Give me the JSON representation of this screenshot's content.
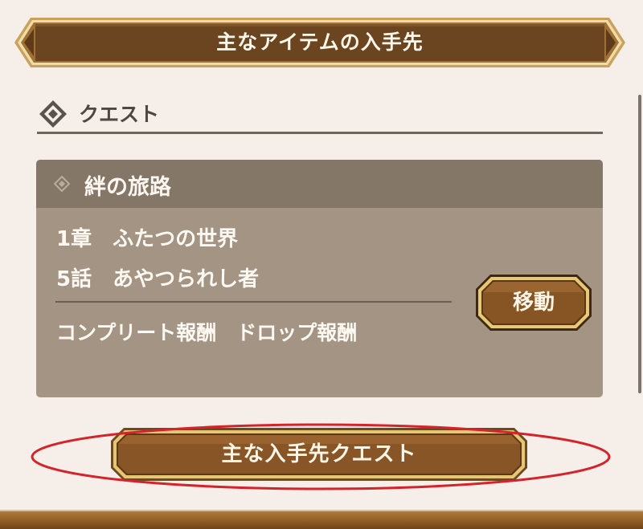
{
  "header": {
    "title": "主なアイテムの入手先"
  },
  "section": {
    "title": "クエスト",
    "icon": "diamond-icon"
  },
  "quest_card": {
    "name": "絆の旅路",
    "chapter": "1章　ふたつの世界",
    "episode": "5話　あやつられし者",
    "rewards": "コンプリート報酬　ドロップ報酬",
    "move_label": "移動",
    "icon": "small-diamond-icon"
  },
  "main_quest_button": {
    "label": "主な入手先クエスト"
  },
  "colors": {
    "background": "#f6eee8",
    "banner": "#6b4420",
    "card": "#a39484",
    "card_header": "#847768",
    "button_brown": "#7d4c1e",
    "button_border": "#e0bf6a",
    "highlight": "#d4232b"
  }
}
